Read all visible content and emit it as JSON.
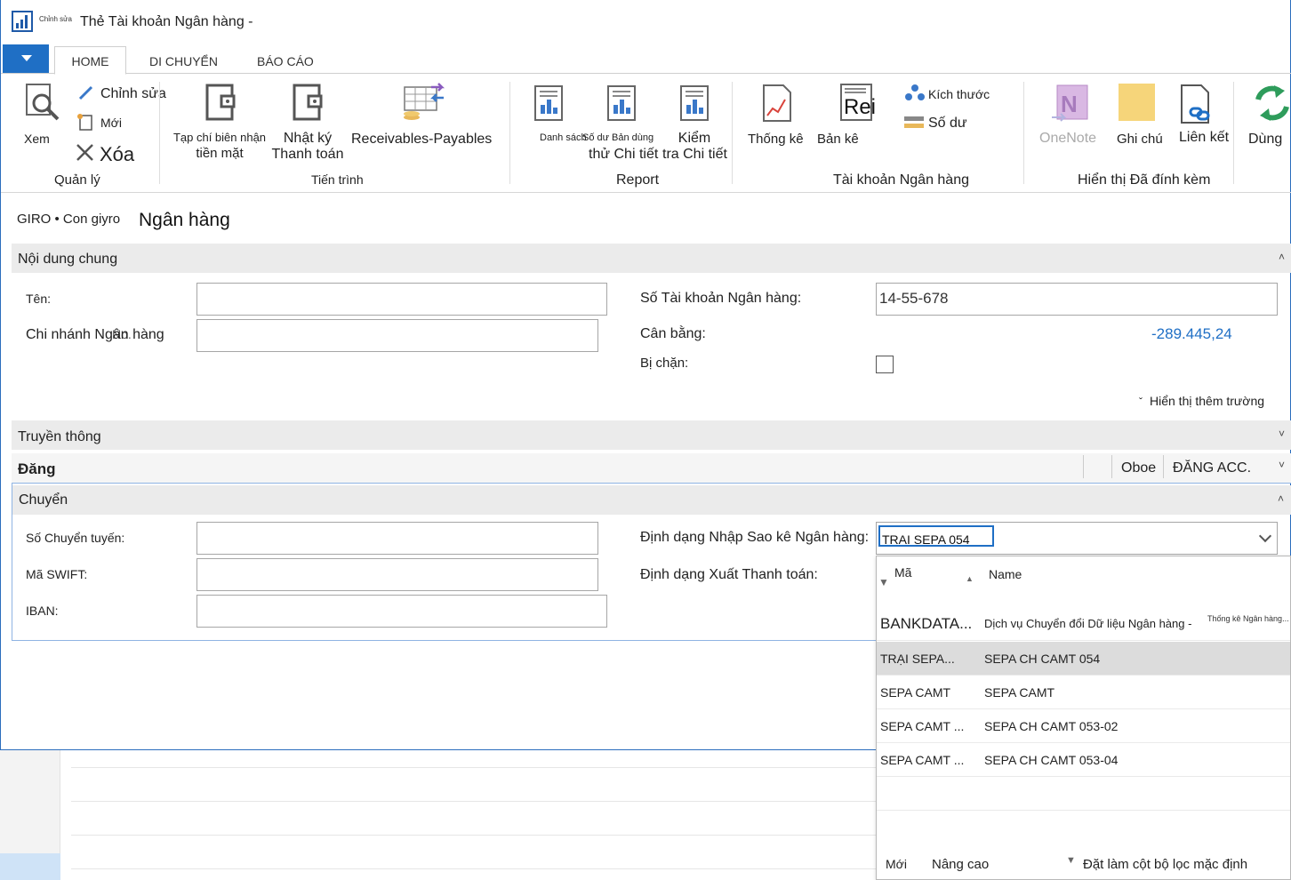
{
  "window": {
    "small_edit_label": "Chỉnh sửa",
    "title": "Thẻ Tài khoản Ngân hàng -"
  },
  "tabs": [
    "HOME",
    "DI CHUYỂN",
    "BÁO CÁO"
  ],
  "ribbon": {
    "manage": {
      "view": "Xem",
      "edit": "Chỉnh sửa",
      "new": "Mới",
      "delete": "Xóa",
      "group": "Quản lý"
    },
    "process": {
      "cash_receipt_line1": "Tạp chí biên nhận",
      "cash_receipt_line2": "tiền mặt",
      "payment_journal_line1": "Nhật ký",
      "payment_journal_line2": "Thanh toán",
      "receivables_payables": "Receivables-Payables",
      "group": "Tiến trình"
    },
    "report": {
      "list_small": "Danh sách",
      "balance_small": "Số dư Bản dùng",
      "detail_line": "thử Chi tiết",
      "check_line1": "Kiểm",
      "check_line2": "tra Chi tiết",
      "group": "Report"
    },
    "bank_account": {
      "statistics": "Thống kê",
      "statement": "Bản kê",
      "rec_text": "Rei",
      "dimensions": "Kích thước",
      "balance": "Số dư",
      "group": "Tài khoản Ngân hàng"
    },
    "attached": {
      "onenote": "OneNote",
      "notes": "Ghi chú",
      "links": "Liên kết",
      "group": "Hiển thị Đã đính kèm"
    },
    "stop": "Dùng"
  },
  "breadcrumb": "GIRO • Con giyro",
  "page_title": "Ngân hàng",
  "general": {
    "title": "Nội dung chung",
    "name_label": "Tên:",
    "branch_label": "Chi nhánh Ngân hàng",
    "branch_overlap": "No.",
    "account_no_label": "Số Tài khoản Ngân hàng:",
    "account_no_value": "14-55-678",
    "balance_label": "Cân bằng:",
    "balance_value": "-289.445,24",
    "blocked_label": "Bị chặn:",
    "show_more": "Hiển thị thêm trường"
  },
  "communication": {
    "title": "Truyền thông"
  },
  "posting": {
    "title": "Đăng",
    "oboe": "Oboe",
    "post_acc": "ĐĂNG ACC."
  },
  "transfer": {
    "title": "Chuyển",
    "routing_label": "Số Chuyển tuyến:",
    "swift_label": "Mã SWIFT:",
    "iban_label": "IBAN:",
    "import_format_label": "Định dạng Nhập Sao kê Ngân hàng:",
    "import_format_value": "TRAI SEPA 054",
    "export_format_label": "Định dạng Xuất Thanh toán:"
  },
  "dropdown": {
    "col_code": "Mã",
    "col_name": "Name",
    "rows": [
      {
        "code": "BANKDATA...",
        "name": "Dịch vụ Chuyển đổi Dữ liệu Ngân hàng -",
        "extra": "Thống kê Ngân hàng..."
      },
      {
        "code": "TRẠI SEPA...",
        "name": "SEPA CH CAMT 054",
        "extra": ""
      },
      {
        "code": "SEPA CAMT",
        "name": "SEPA CAMT",
        "extra": ""
      },
      {
        "code": "SEPA CAMT ...",
        "name": "SEPA CH CAMT 053-02",
        "extra": ""
      },
      {
        "code": "SEPA CAMT ...",
        "name": "SEPA CH CAMT 053-04",
        "extra": ""
      }
    ],
    "footer": {
      "new": "Mới",
      "advanced": "Nâng cao",
      "set_default_filter": "Đặt làm cột bộ lọc mặc định"
    }
  },
  "colors": {
    "accent": "#1f6fc5",
    "fasttab_bg": "#ebebeb",
    "selected_row": "#dcdcdc"
  }
}
